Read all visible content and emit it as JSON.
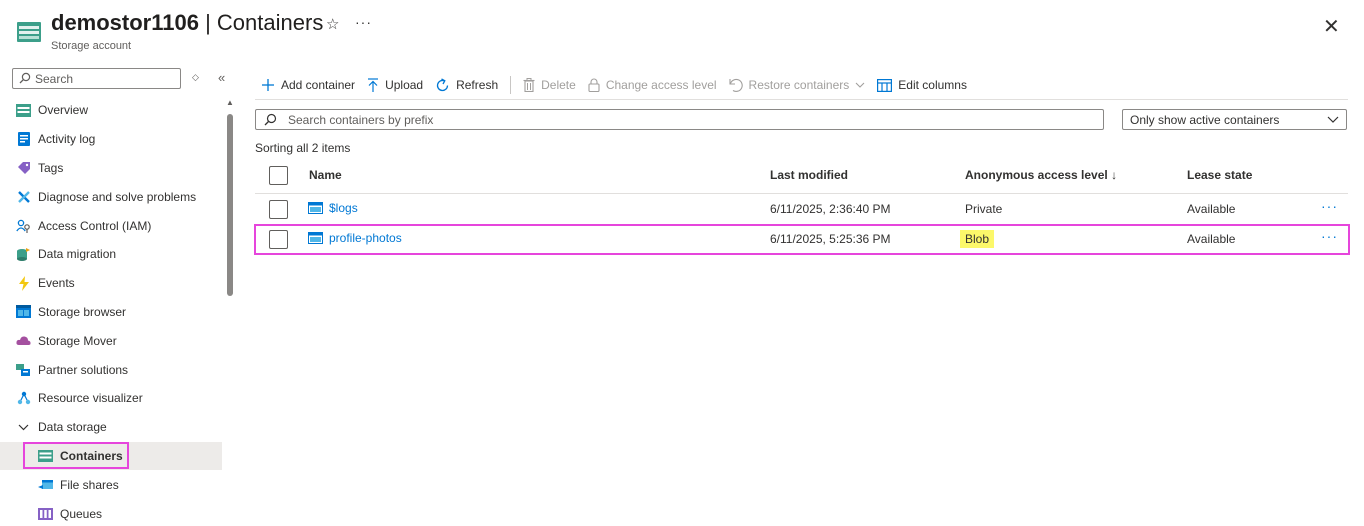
{
  "header": {
    "resource_name": "demostor1106",
    "separator": " | ",
    "page_title": "Containers",
    "subtitle": "Storage account",
    "favorite_icon": "star-icon",
    "more_label": "···",
    "close_label": "✕"
  },
  "sidebar": {
    "search_placeholder": "Search",
    "updown_label": "◇",
    "collapse_label": "«",
    "items": [
      {
        "label": "Overview",
        "icon": "overview-icon"
      },
      {
        "label": "Activity log",
        "icon": "activity-log-icon"
      },
      {
        "label": "Tags",
        "icon": "tag-icon"
      },
      {
        "label": "Diagnose and solve problems",
        "icon": "wrench-icon"
      },
      {
        "label": "Access Control (IAM)",
        "icon": "people-icon"
      },
      {
        "label": "Data migration",
        "icon": "migration-icon"
      },
      {
        "label": "Events",
        "icon": "lightning-icon"
      },
      {
        "label": "Storage browser",
        "icon": "storage-browser-icon"
      },
      {
        "label": "Storage Mover",
        "icon": "cloud-icon"
      },
      {
        "label": "Partner solutions",
        "icon": "partner-icon"
      },
      {
        "label": "Resource visualizer",
        "icon": "visualizer-icon"
      }
    ],
    "group": {
      "label": "Data storage",
      "chevron": "﹀"
    },
    "children": [
      {
        "label": "Containers",
        "icon": "container-icon",
        "active": true
      },
      {
        "label": "File shares",
        "icon": "file-share-icon"
      },
      {
        "label": "Queues",
        "icon": "queue-icon"
      }
    ]
  },
  "toolbar": {
    "add_container": "Add container",
    "upload": "Upload",
    "refresh": "Refresh",
    "delete": "Delete",
    "change_access_level": "Change access level",
    "restore_containers": "Restore containers",
    "edit_columns": "Edit columns"
  },
  "filter": {
    "search_placeholder": "Search containers by prefix",
    "status_value": "Only show active containers"
  },
  "sort_info": "Sorting all 2 items",
  "table": {
    "headers": {
      "name": "Name",
      "last_modified": "Last modified",
      "access_level": "Anonymous access level ↓",
      "lease_state": "Lease state"
    },
    "rows": [
      {
        "name": "$logs",
        "last_modified": "6/11/2025, 2:36:40 PM",
        "access_level": "Private",
        "lease_state": "Available",
        "more": "···"
      },
      {
        "name": "profile-photos",
        "last_modified": "6/11/2025, 5:25:36 PM",
        "access_level": "Blob",
        "lease_state": "Available",
        "more": "···"
      }
    ]
  },
  "colors": {
    "accent": "#0078d4",
    "highlight_outline": "#e645dc",
    "highlight_fill": "#fcf86a"
  }
}
